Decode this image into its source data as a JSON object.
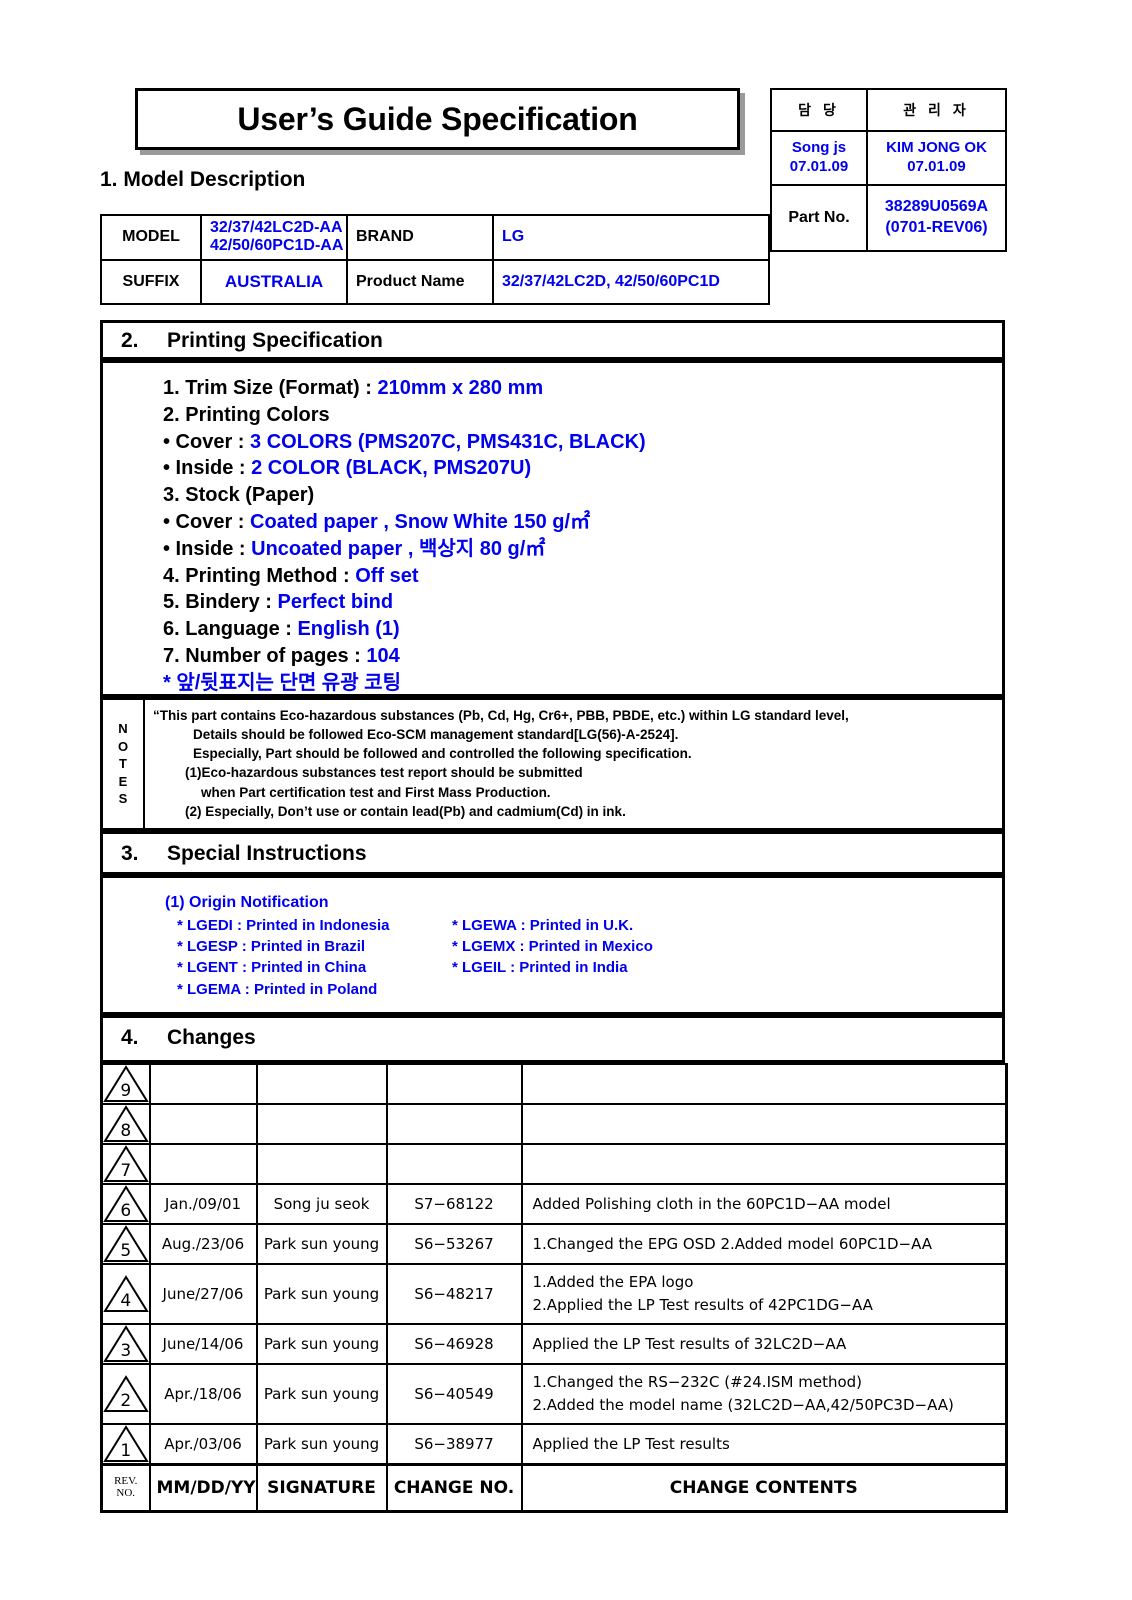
{
  "title": "User’s Guide Specification",
  "approval": {
    "col1_header": "담  당",
    "col2_header": "관 리 자",
    "col1_signer": "Song js",
    "col1_date": "07.01.09",
    "col2_signer": "KIM JONG OK",
    "col2_date": "07.01.09",
    "part_no_label": "Part No.",
    "part_no_value": "38289U0569A",
    "part_no_rev": "(0701-REV06)"
  },
  "section1": {
    "heading": "1. Model Description",
    "model_label": "MODEL",
    "model_value_line1": "32/37/42LC2D-AA",
    "model_value_line2": "42/50/60PC1D-AA",
    "brand_label": "BRAND",
    "brand_value": "LG",
    "suffix_label": "SUFFIX",
    "suffix_value": "AUSTRALIA",
    "product_name_label": "Product Name",
    "product_name_value": "32/37/42LC2D, 42/50/60PC1D"
  },
  "section2": {
    "number": "2.",
    "heading": "Printing Specification",
    "items": [
      {
        "label": "1. Trim Size (Format) : ",
        "value": "210mm x 280 mm"
      },
      {
        "label": "2. Printing Colors",
        "value": ""
      },
      {
        "label": "• Cover : ",
        "value": "3 COLORS (PMS207C, PMS431C, BLACK)"
      },
      {
        "label": "• Inside : ",
        "value": "2 COLOR (BLACK, PMS207U)"
      },
      {
        "label": "3. Stock (Paper)",
        "value": ""
      },
      {
        "label": "• Cover : ",
        "value": "Coated paper , Snow White 150 g/㎡"
      },
      {
        "label": "• Inside : ",
        "value": "Uncoated paper , 백상지 80 g/㎡"
      },
      {
        "label": "4. Printing Method : ",
        "value": "Off set"
      },
      {
        "label": "5. Bindery  : ",
        "value": "Perfect bind"
      },
      {
        "label": "6. Language : ",
        "value": "English (1)"
      },
      {
        "label": "7. Number of pages : ",
        "value": "104"
      }
    ],
    "footnote": "* 앞/뒷표지는 단면 유광 코팅"
  },
  "notes": {
    "label_chars": [
      "N",
      "O",
      "T",
      "E",
      "S"
    ],
    "lines": [
      "“This part contains Eco-hazardous substances (Pb, Cd, Hg, Cr6+, PBB, PBDE, etc.) within LG standard level,",
      "Details should be followed Eco-SCM management standard[LG(56)-A-2524].",
      "Especially, Part should be followed and controlled the following specification.",
      "(1)Eco-hazardous substances test report should be submitted",
      "when  Part certification test and First Mass Production.",
      "(2) Especially, Don’t use or contain lead(Pb) and cadmium(Cd) in ink."
    ]
  },
  "section3": {
    "number": "3.",
    "heading": "Special Instructions",
    "origin_title": "(1) Origin Notification",
    "origin_rows": [
      {
        "left": "* LGEDI : Printed in Indonesia",
        "right": "* LGEWA : Printed in U.K."
      },
      {
        "left": "* LGESP : Printed in Brazil",
        "right": "* LGEMX : Printed in Mexico"
      },
      {
        "left": "* LGENT : Printed in China",
        "right": "* LGEIL : Printed in India"
      },
      {
        "left": "* LGEMA : Printed in Poland",
        "right": ""
      }
    ]
  },
  "section4": {
    "number": "4.",
    "heading": "Changes",
    "footer": {
      "rev_no_line1": "REV.",
      "rev_no_line2": "NO.",
      "date": "MM/DD/YY",
      "signature": "SIGNATURE",
      "change_no": "CHANGE NO.",
      "change_contents": "CHANGE   CONTENTS"
    },
    "rows": [
      {
        "rev": "9",
        "date": "",
        "signature": "",
        "change_no": "",
        "contents": [
          "",
          ""
        ]
      },
      {
        "rev": "8",
        "date": "",
        "signature": "",
        "change_no": "",
        "contents": [
          "",
          ""
        ]
      },
      {
        "rev": "7",
        "date": "",
        "signature": "",
        "change_no": "",
        "contents": [
          "",
          ""
        ]
      },
      {
        "rev": "6",
        "date": "Jan./09/01",
        "signature": "Song ju seok",
        "change_no": "S7−68122",
        "contents": [
          "Added Polishing cloth in the 60PC1D−AA model",
          ""
        ]
      },
      {
        "rev": "5",
        "date": "Aug./23/06",
        "signature": "Park sun young",
        "change_no": "S6−53267",
        "contents": [
          "1.Changed the EPG OSD   2.Added model 60PC1D−AA",
          ""
        ]
      },
      {
        "rev": "4",
        "date": "June/27/06",
        "signature": "Park sun young",
        "change_no": "S6−48217",
        "contents": [
          "1.Added the EPA logo",
          "2.Applied the LP Test results of 42PC1DG−AA"
        ]
      },
      {
        "rev": "3",
        "date": "June/14/06",
        "signature": "Park sun young",
        "change_no": "S6−46928",
        "contents": [
          "Applied the LP Test results of 32LC2D−AA",
          ""
        ]
      },
      {
        "rev": "2",
        "date": "Apr./18/06",
        "signature": "Park sun young",
        "change_no": "S6−40549",
        "contents": [
          "1.Changed the RS−232C (#24.ISM method)",
          "2.Added the model name (32LC2D−AA,42/50PC3D−AA)"
        ]
      },
      {
        "rev": "1",
        "date": "Apr./03/06",
        "signature": "Park sun young",
        "change_no": "S6−38977",
        "contents": [
          "Applied the LP Test results",
          ""
        ]
      }
    ]
  }
}
